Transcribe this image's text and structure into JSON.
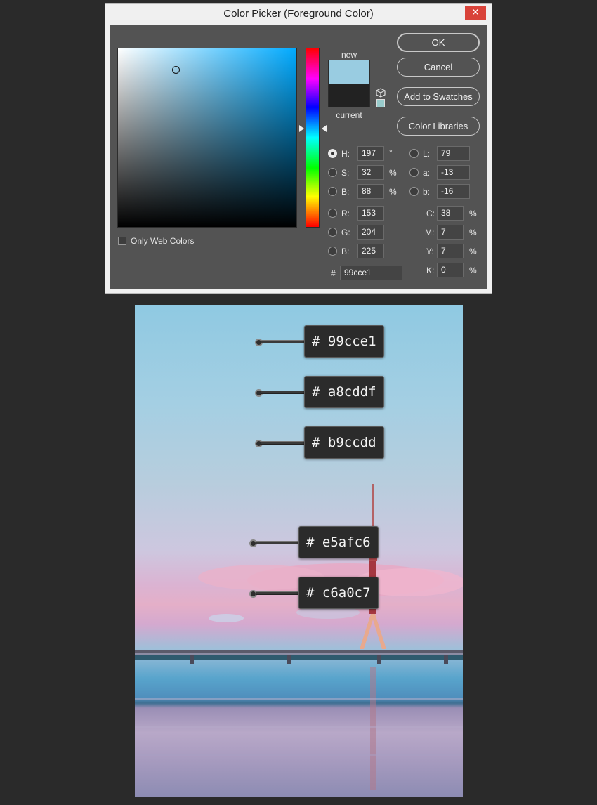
{
  "dialog": {
    "title": "Color Picker (Foreground Color)",
    "close_glyph": "✕",
    "new_label": "new",
    "current_label": "current",
    "new_color": "#99cce1",
    "current_color": "#222222",
    "only_web_colors_label": "Only Web Colors",
    "buttons": {
      "ok": "OK",
      "cancel": "Cancel",
      "add_to_swatches": "Add to Swatches",
      "color_libraries": "Color Libraries"
    },
    "hsb": {
      "h_label": "H:",
      "h_value": "197",
      "h_unit": "°",
      "s_label": "S:",
      "s_value": "32",
      "s_unit": "%",
      "b_label": "B:",
      "b_value": "88",
      "b_unit": "%"
    },
    "rgb": {
      "r_label": "R:",
      "r_value": "153",
      "g_label": "G:",
      "g_value": "204",
      "b_label": "B:",
      "b_value": "225"
    },
    "lab": {
      "l_label": "L:",
      "l_value": "79",
      "a_label": "a:",
      "a_value": "-13",
      "b_label": "b:",
      "b_value": "-16"
    },
    "cmyk": {
      "c_label": "C:",
      "c_value": "38",
      "c_unit": "%",
      "m_label": "M:",
      "m_value": "7",
      "m_unit": "%",
      "y_label": "Y:",
      "y_value": "7",
      "y_unit": "%",
      "k_label": "K:",
      "k_value": "0",
      "k_unit": "%"
    },
    "hex": {
      "label": "#",
      "value": "99cce1"
    },
    "icons": {
      "close": "close-icon",
      "web_safe": "cube-icon"
    }
  },
  "photo": {
    "callouts": [
      {
        "label": "# 99cce1"
      },
      {
        "label": "# a8cddf"
      },
      {
        "label": "# b9ccdd"
      },
      {
        "label": "# e5afc6"
      },
      {
        "label": "# c6a0c7"
      }
    ]
  }
}
